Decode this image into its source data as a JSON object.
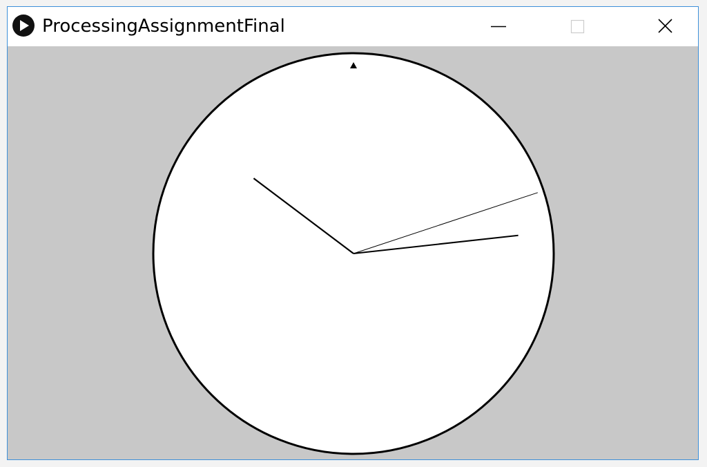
{
  "window": {
    "title": "ProcessingAssignmentFinal",
    "app_icon": "processing-play-icon",
    "controls": {
      "minimize_icon": "minimize-icon",
      "maximize_icon": "maximize-icon",
      "close_icon": "close-icon"
    },
    "border_color": "#3c8fd9"
  },
  "sketch": {
    "background_color": "#c8c8c8",
    "clock_face_color": "#ffffff",
    "stroke_color": "#000000",
    "top_marker_icon": "triangle-up-icon",
    "hands": [
      {
        "name": "hour-hand",
        "angle_deg": -53
      },
      {
        "name": "minute-hand",
        "angle_deg": 83.7
      },
      {
        "name": "second-hand",
        "angle_deg": 71.7
      }
    ]
  }
}
